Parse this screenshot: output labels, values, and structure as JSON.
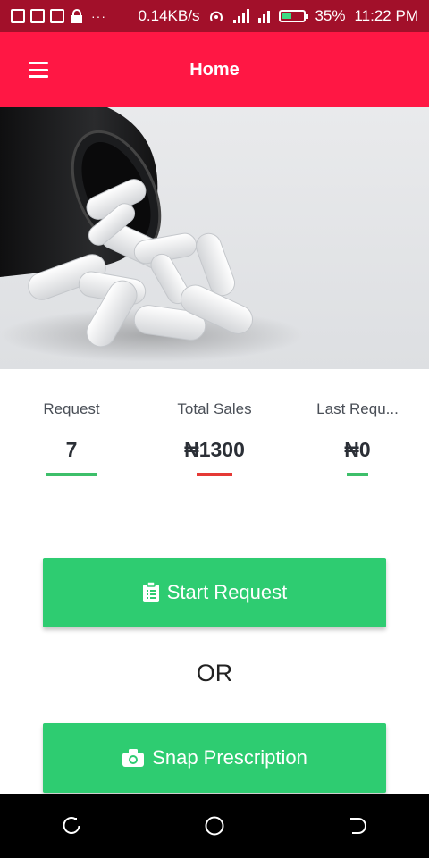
{
  "status_bar": {
    "speed": "0.14KB/s",
    "battery": "35%",
    "time": "11:22 PM",
    "dots": "···"
  },
  "app_bar": {
    "title": "Home"
  },
  "stats": [
    {
      "label": "Request",
      "value": "7",
      "bar_color": "#3dbf6a"
    },
    {
      "label": "Total Sales",
      "value": "₦1300",
      "bar_color": "#e53935"
    },
    {
      "label": "Last Requ...",
      "value": "₦0",
      "bar_color": "#3dbf6a"
    }
  ],
  "buttons": {
    "start_request": "Start Request",
    "or": "OR",
    "snap_prescription": "Snap Prescription"
  },
  "colors": {
    "status_bar": "#a2102a",
    "app_bar": "#ff1744",
    "button_green": "#2ecc71"
  }
}
